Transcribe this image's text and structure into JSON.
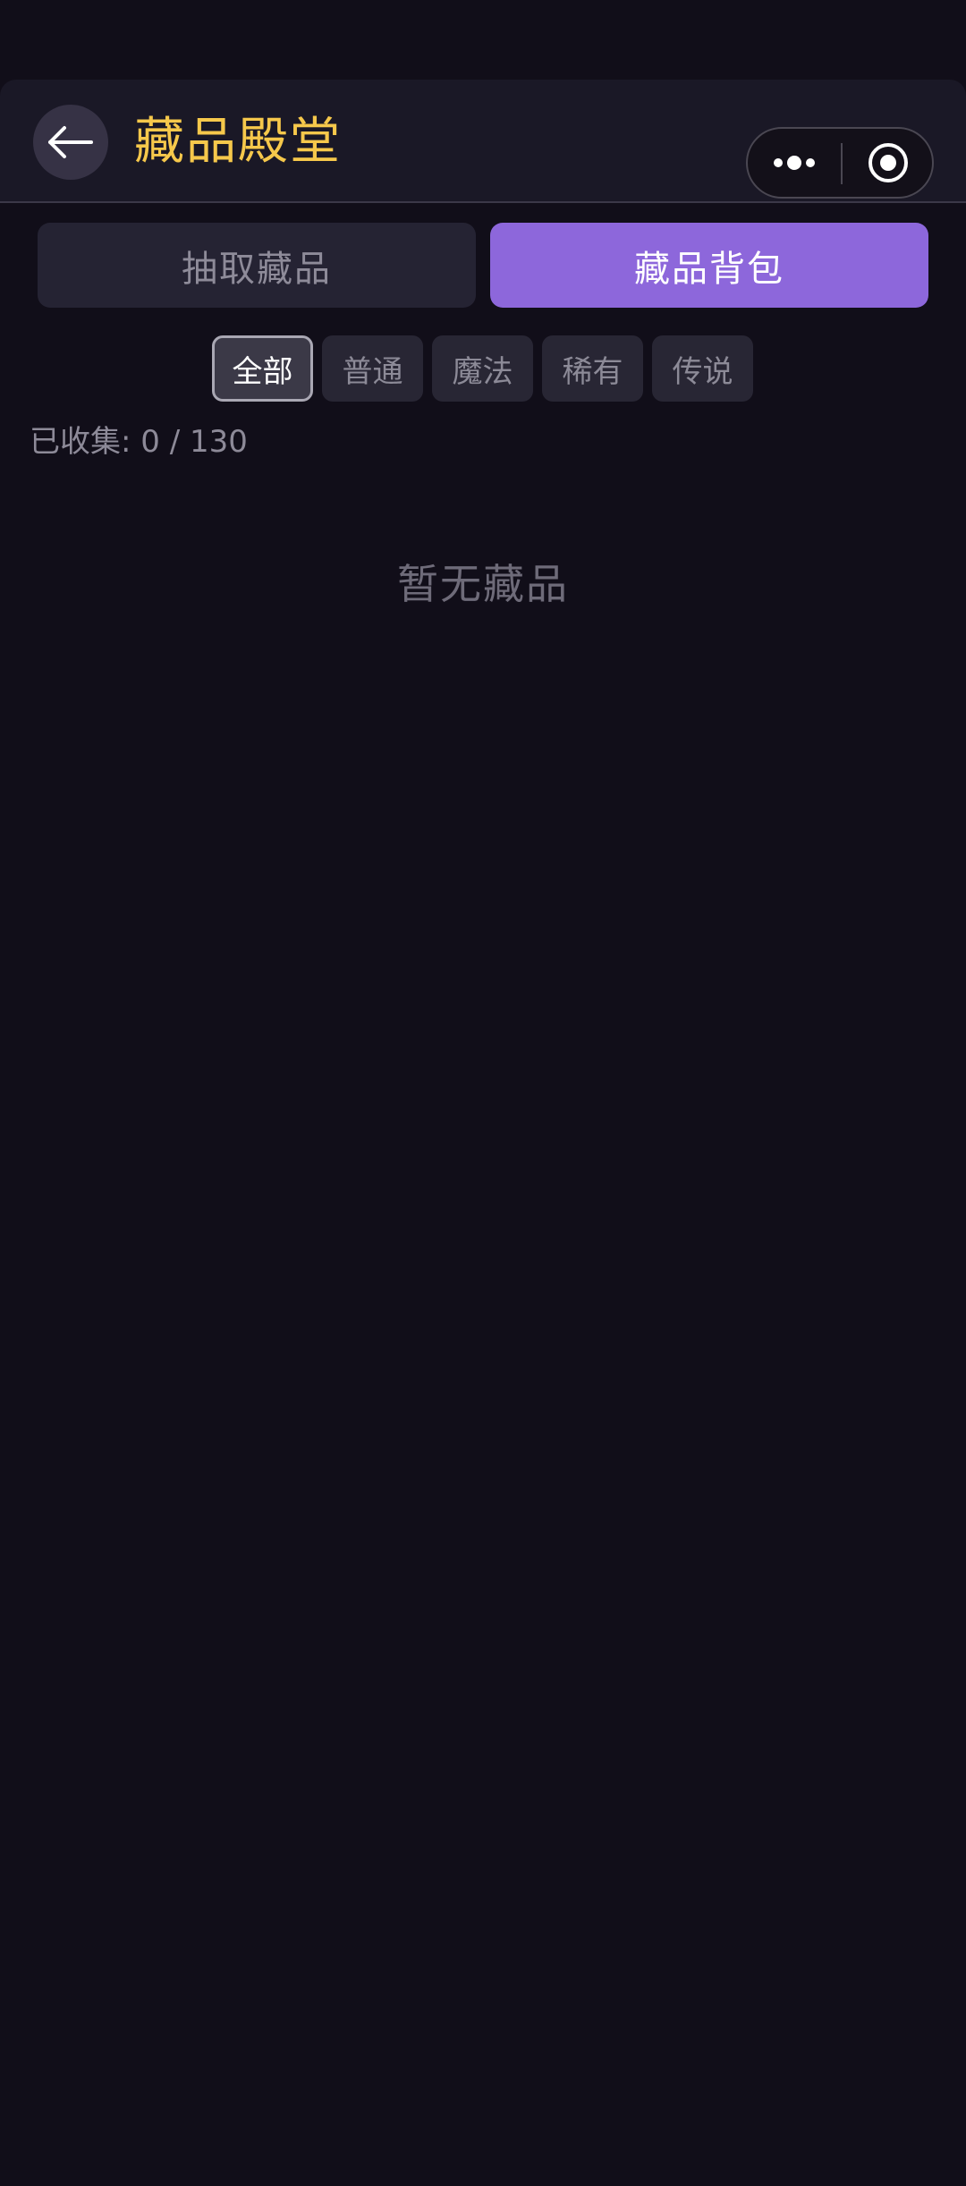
{
  "header": {
    "title": "藏品殿堂",
    "title_color": "#f6c84b",
    "back_icon": "arrow-left-icon",
    "capsule_icons": [
      "more-dots-icon",
      "record-target-icon"
    ]
  },
  "tabs": [
    {
      "label": "抽取藏品",
      "active": false
    },
    {
      "label": "藏品背包",
      "active": true
    }
  ],
  "accent_color": "#8d67db",
  "filters": [
    {
      "label": "全部",
      "active": true
    },
    {
      "label": "普通",
      "active": false
    },
    {
      "label": "魔法",
      "active": false
    },
    {
      "label": "稀有",
      "active": false
    },
    {
      "label": "传说",
      "active": false
    }
  ],
  "collection": {
    "text": "已收集: 0 / 130"
  },
  "empty_state": {
    "text": "暂无藏品"
  }
}
